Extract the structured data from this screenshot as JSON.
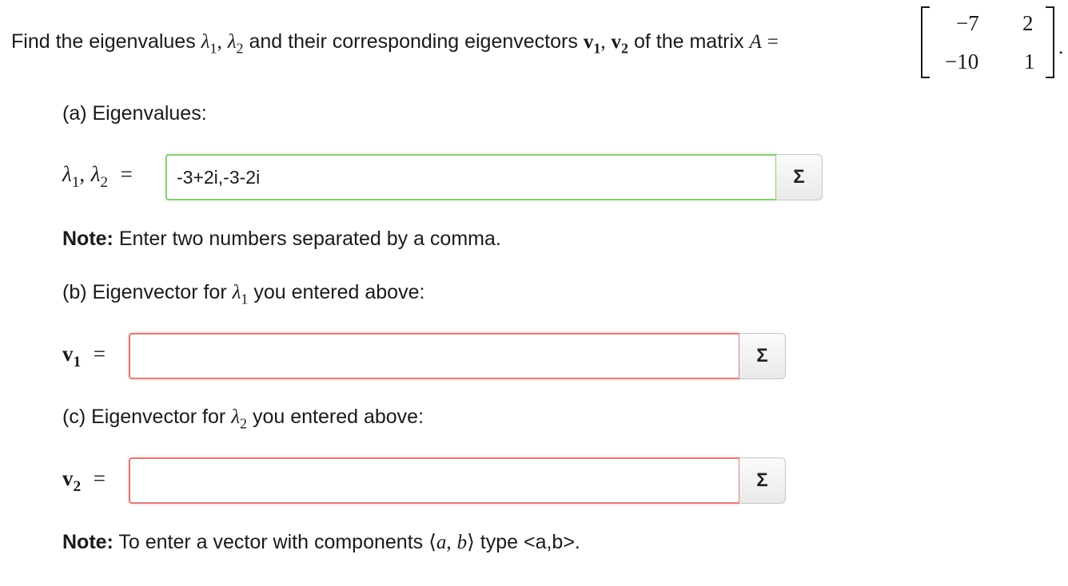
{
  "question": {
    "prefix": "Find the eigenvalues",
    "lambda": "λ",
    "sub1": "1",
    "sub2": "2",
    "comma": ",",
    "and_text": "and their corresponding eigenvectors",
    "v": "v",
    "of_text": "of the matrix",
    "A": "A",
    "equals": "=",
    "period": "."
  },
  "matrix": {
    "rows": [
      [
        "−7",
        "2"
      ],
      [
        "−10",
        "1"
      ]
    ]
  },
  "part_a": {
    "heading": "(a) Eigenvalues:",
    "answer_value": "-3+2i,-3-2i",
    "note_bold": "Note:",
    "note_text": " Enter two numbers separated by a comma."
  },
  "part_b": {
    "heading_prefix": "(b) Eigenvector for",
    "heading_suffix": "you entered above:",
    "answer_value": ""
  },
  "part_c": {
    "heading_prefix": "(c) Eigenvector for",
    "heading_suffix": "you entered above:",
    "answer_value": ""
  },
  "footer_note": {
    "bold": "Note:",
    "text_before": " To enter a vector with components ",
    "langle": "⟨",
    "a": "a",
    "b": "b",
    "rangle": "⟩",
    "text_after": " type <a,b>."
  },
  "sigma_label": "Σ",
  "colors": {
    "correct_border": "#8fca7d",
    "incorrect_border": "#d98080"
  }
}
